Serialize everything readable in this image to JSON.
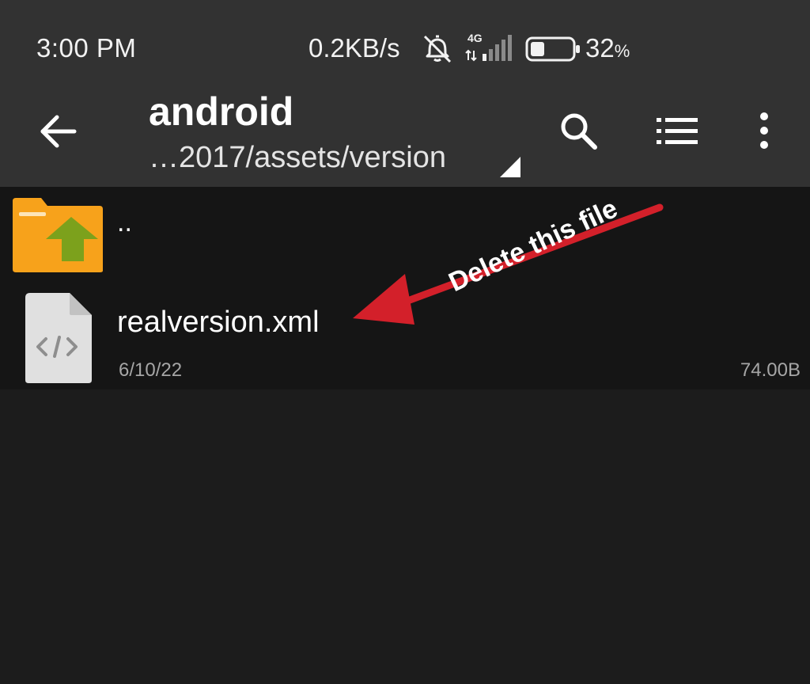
{
  "status_bar": {
    "time": "3:00 PM",
    "net_speed": "0.2KB/s",
    "net_type": "4G",
    "battery_value": "32",
    "battery_unit": "%",
    "icons": [
      "bell-off-icon",
      "signal-icon",
      "battery-icon"
    ]
  },
  "toolbar": {
    "title": "android",
    "path": "…2017/assets/version",
    "icons": [
      "back-arrow-icon",
      "dropdown-triangle-icon",
      "search-icon",
      "list-view-icon",
      "more-vert-icon"
    ]
  },
  "files": {
    "parent": {
      "label": ".."
    },
    "items": [
      {
        "name": "realversion.xml",
        "date": "6/10/22",
        "size": "74.00B",
        "icon": "xml-file-icon"
      }
    ]
  },
  "annotation": {
    "text": "Delete this file",
    "color": "#d3202a"
  },
  "colors": {
    "background": "#1c1c1c",
    "bar": "#323232",
    "list": "#151515",
    "folder": "#f7a21b",
    "up_arrow": "#7ca11c",
    "file_icon": "#e0e0e0"
  }
}
